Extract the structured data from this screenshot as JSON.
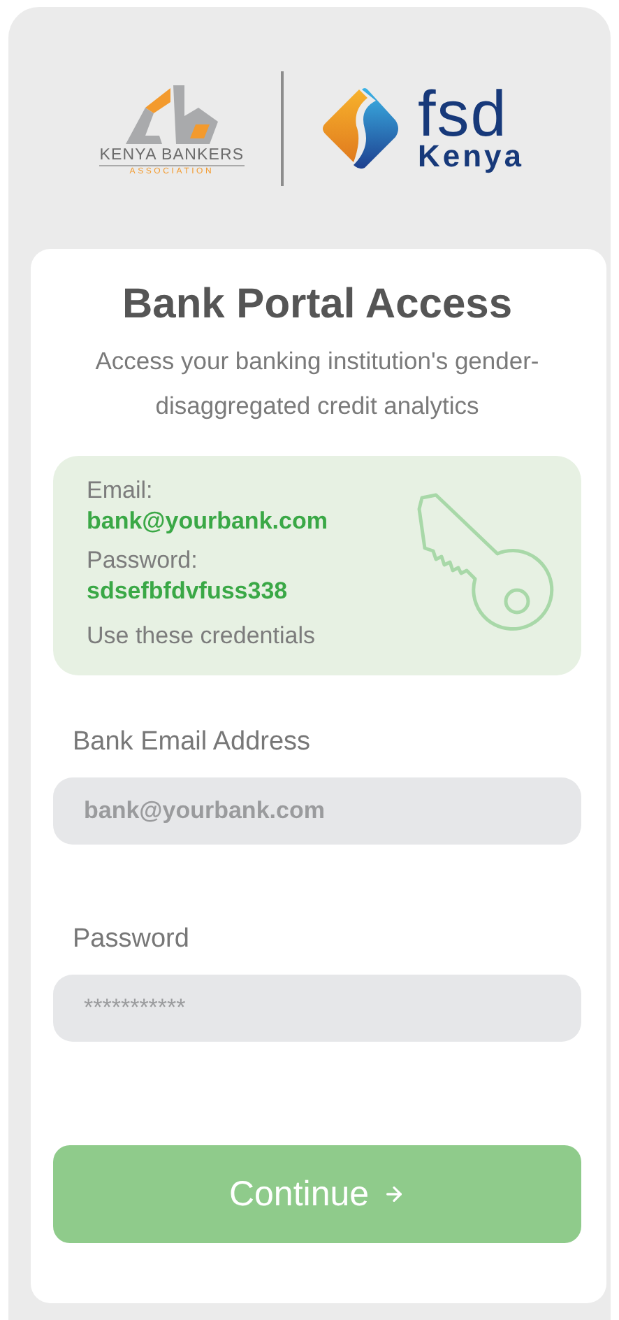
{
  "logos": {
    "kba_name": "KENYA BANKERS",
    "kba_sub": "ASSOCIATION",
    "fsd_name": "fsd",
    "fsd_sub": "Kenya"
  },
  "title": "Bank Portal Access",
  "subtitle": "Access your banking institution's gender-disaggregated credit analytics",
  "credentials": {
    "email_label": "Email:",
    "email": "bank@yourbank.com",
    "password_label": "Password:",
    "password": "sdsefbfdvfuss338",
    "note": "Use these credentials"
  },
  "fields": [
    {
      "label": "Bank Email Address",
      "placeholder": "bank@yourbank.com",
      "kind": "email"
    },
    {
      "label": "Password",
      "placeholder": "***********",
      "kind": "password"
    }
  ],
  "button": {
    "label": "Continue",
    "disabled": true
  }
}
